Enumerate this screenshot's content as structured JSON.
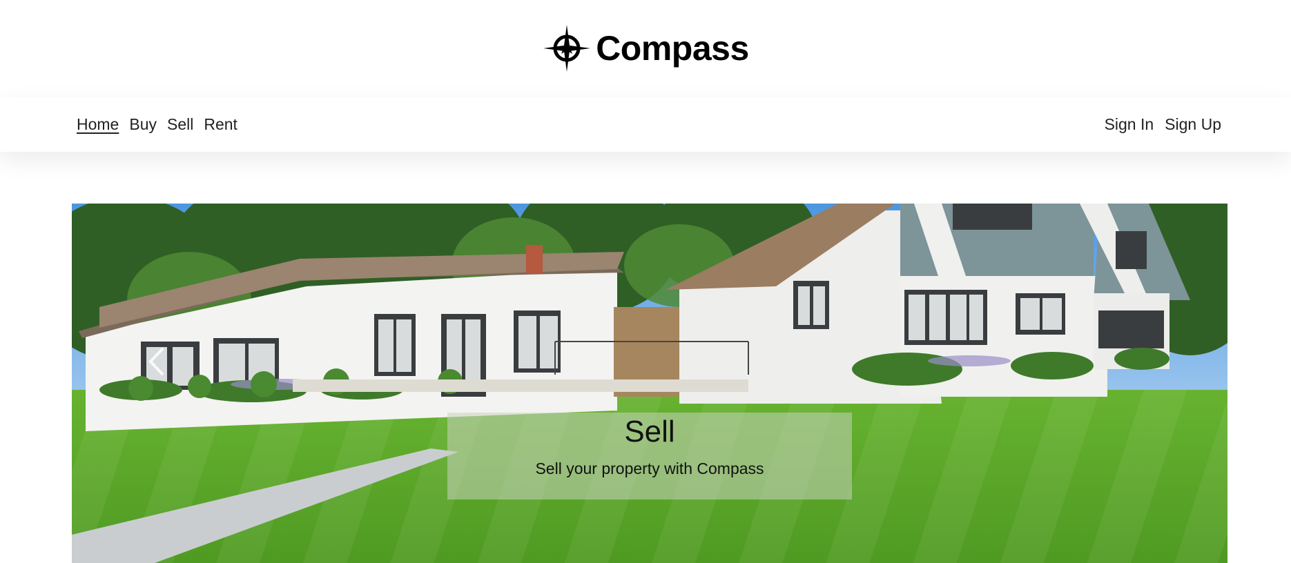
{
  "brand": {
    "name": "Compass",
    "logo_icon": "compass-rose-icon"
  },
  "nav": {
    "left": [
      {
        "label": "Home",
        "active": true
      },
      {
        "label": "Buy"
      },
      {
        "label": "Sell"
      },
      {
        "label": "Rent"
      }
    ],
    "right": [
      {
        "label": "Sign In"
      },
      {
        "label": "Sign Up"
      }
    ]
  },
  "carousel": {
    "caption_title": "Sell",
    "caption_subtitle": "Sell your property with Compass",
    "prev_icon": "chevron-left-icon",
    "image_subject": "house-photo"
  },
  "colors": {
    "sky": "#5aa2e6",
    "lawn": "#5fae2e",
    "nav_text": "#222222",
    "caption_bg": "#c8d2be"
  }
}
